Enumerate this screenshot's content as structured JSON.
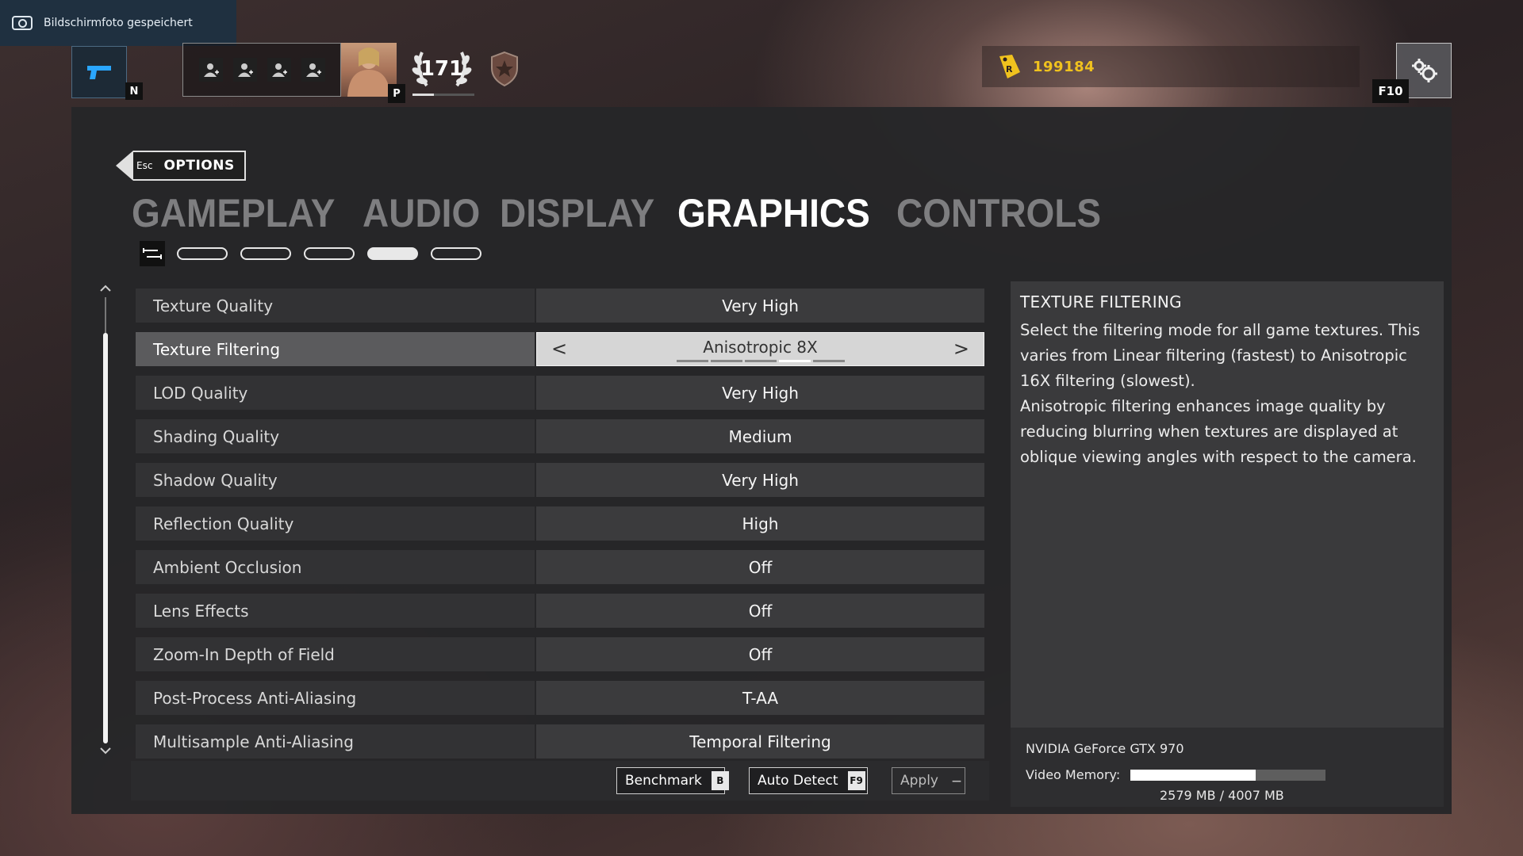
{
  "toast": {
    "text": "Bildschirmfoto gespeichert",
    "icon": "camera-icon"
  },
  "topbar": {
    "weapon_key": "N",
    "profile_key": "P",
    "level": "171",
    "level_progress": 0.35,
    "credits": "199184",
    "settings_key": "F10",
    "accent_color": "#f0c21e"
  },
  "options": {
    "esc_label": "Esc",
    "label": "OPTIONS"
  },
  "tabs": [
    {
      "label": "GAMEPLAY",
      "active": false
    },
    {
      "label": "AUDIO",
      "active": false
    },
    {
      "label": "DISPLAY",
      "active": false
    },
    {
      "label": "GRAPHICS",
      "active": true
    },
    {
      "label": "CONTROLS",
      "active": false
    }
  ],
  "subtabs": {
    "count": 5,
    "active_index": 3
  },
  "settings": [
    {
      "name": "Texture Quality",
      "value": "Very High"
    },
    {
      "name": "Texture Filtering",
      "value": "Anisotropic 8X",
      "selected": true
    },
    {
      "name": "LOD Quality",
      "value": "Very High"
    },
    {
      "name": "Shading Quality",
      "value": "Medium"
    },
    {
      "name": "Shadow Quality",
      "value": "Very High"
    },
    {
      "name": "Reflection Quality",
      "value": "High"
    },
    {
      "name": "Ambient Occlusion",
      "value": "Off"
    },
    {
      "name": "Lens Effects",
      "value": "Off"
    },
    {
      "name": "Zoom-In Depth of Field",
      "value": "Off"
    },
    {
      "name": "Post-Process Anti-Aliasing",
      "value": "T-AA"
    },
    {
      "name": "Multisample Anti-Aliasing",
      "value": "Temporal Filtering"
    }
  ],
  "selector": {
    "prev": "<",
    "next": ">",
    "option_count": 5,
    "option_index": 3
  },
  "buttons": {
    "benchmark": {
      "label": "Benchmark",
      "key": "B"
    },
    "auto_detect": {
      "label": "Auto Detect",
      "key": "F9"
    },
    "apply": {
      "label": "Apply",
      "key": "—"
    }
  },
  "description": {
    "title": "TEXTURE FILTERING",
    "text1": "Select the filtering mode for all game textures. This varies from Linear filtering (fastest) to Anisotropic 16X filtering (slowest).",
    "text2": "Anisotropic filtering enhances image quality by reducing blurring when textures are displayed at oblique viewing angles with respect to the camera."
  },
  "gpu": {
    "name": "NVIDIA GeForce GTX 970",
    "memory_label": "Video Memory:",
    "memory_text": "2579 MB / 4007 MB",
    "memory_used_mb": 2579,
    "memory_total_mb": 4007
  }
}
